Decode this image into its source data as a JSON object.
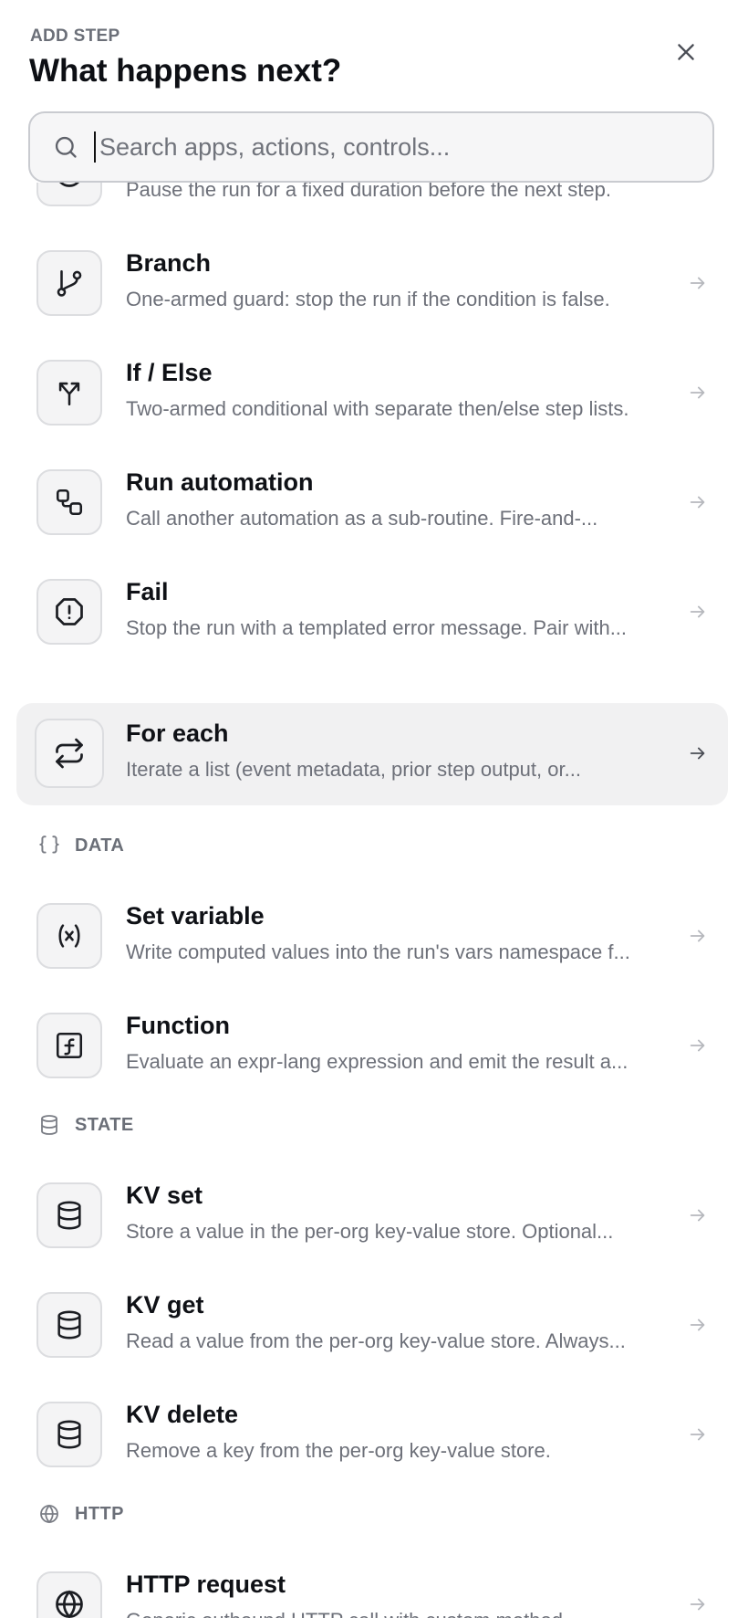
{
  "header": {
    "kicker": "ADD STEP",
    "title": "What happens next?"
  },
  "search": {
    "placeholder": "Search apps, actions, controls...",
    "value": ""
  },
  "items": [
    {
      "name": "",
      "desc": "Pause the run for a fixed duration before the next step.",
      "icon": "clock-icon"
    },
    {
      "name": "Branch",
      "desc": "One-armed guard: stop the run if the condition is false.",
      "icon": "git-branch-icon"
    },
    {
      "name": "If / Else",
      "desc": "Two-armed conditional with separate then/else step lists.",
      "icon": "split-icon"
    },
    {
      "name": "Run automation",
      "desc": "Call another automation as a sub-routine. Fire-and-...",
      "icon": "workflow-icon"
    },
    {
      "name": "Fail",
      "desc": "Stop the run with a templated error message. Pair with...",
      "icon": "octagon-alert-icon"
    },
    {
      "name": "For each",
      "desc": "Iterate a list (event metadata, prior step output, or...",
      "icon": "repeat-icon"
    },
    {
      "name": "Set variable",
      "desc": "Write computed values into the run's vars namespace f...",
      "icon": "variable-icon"
    },
    {
      "name": "Function",
      "desc": "Evaluate an expr-lang expression and emit the result a...",
      "icon": "function-icon"
    },
    {
      "name": "KV set",
      "desc": "Store a value in the per-org key-value store. Optional...",
      "icon": "database-icon"
    },
    {
      "name": "KV get",
      "desc": "Read a value from the per-org key-value store. Always...",
      "icon": "database-icon"
    },
    {
      "name": "KV delete",
      "desc": "Remove a key from the per-org key-value store.",
      "icon": "database-icon"
    },
    {
      "name": "HTTP request",
      "desc": "Generic outbound HTTP call with custom method,...",
      "icon": "globe-icon"
    }
  ],
  "sections": [
    {
      "label": "DATA",
      "icon": "braces-icon"
    },
    {
      "label": "STATE",
      "icon": "database-icon"
    },
    {
      "label": "HTTP",
      "icon": "globe-icon"
    }
  ]
}
